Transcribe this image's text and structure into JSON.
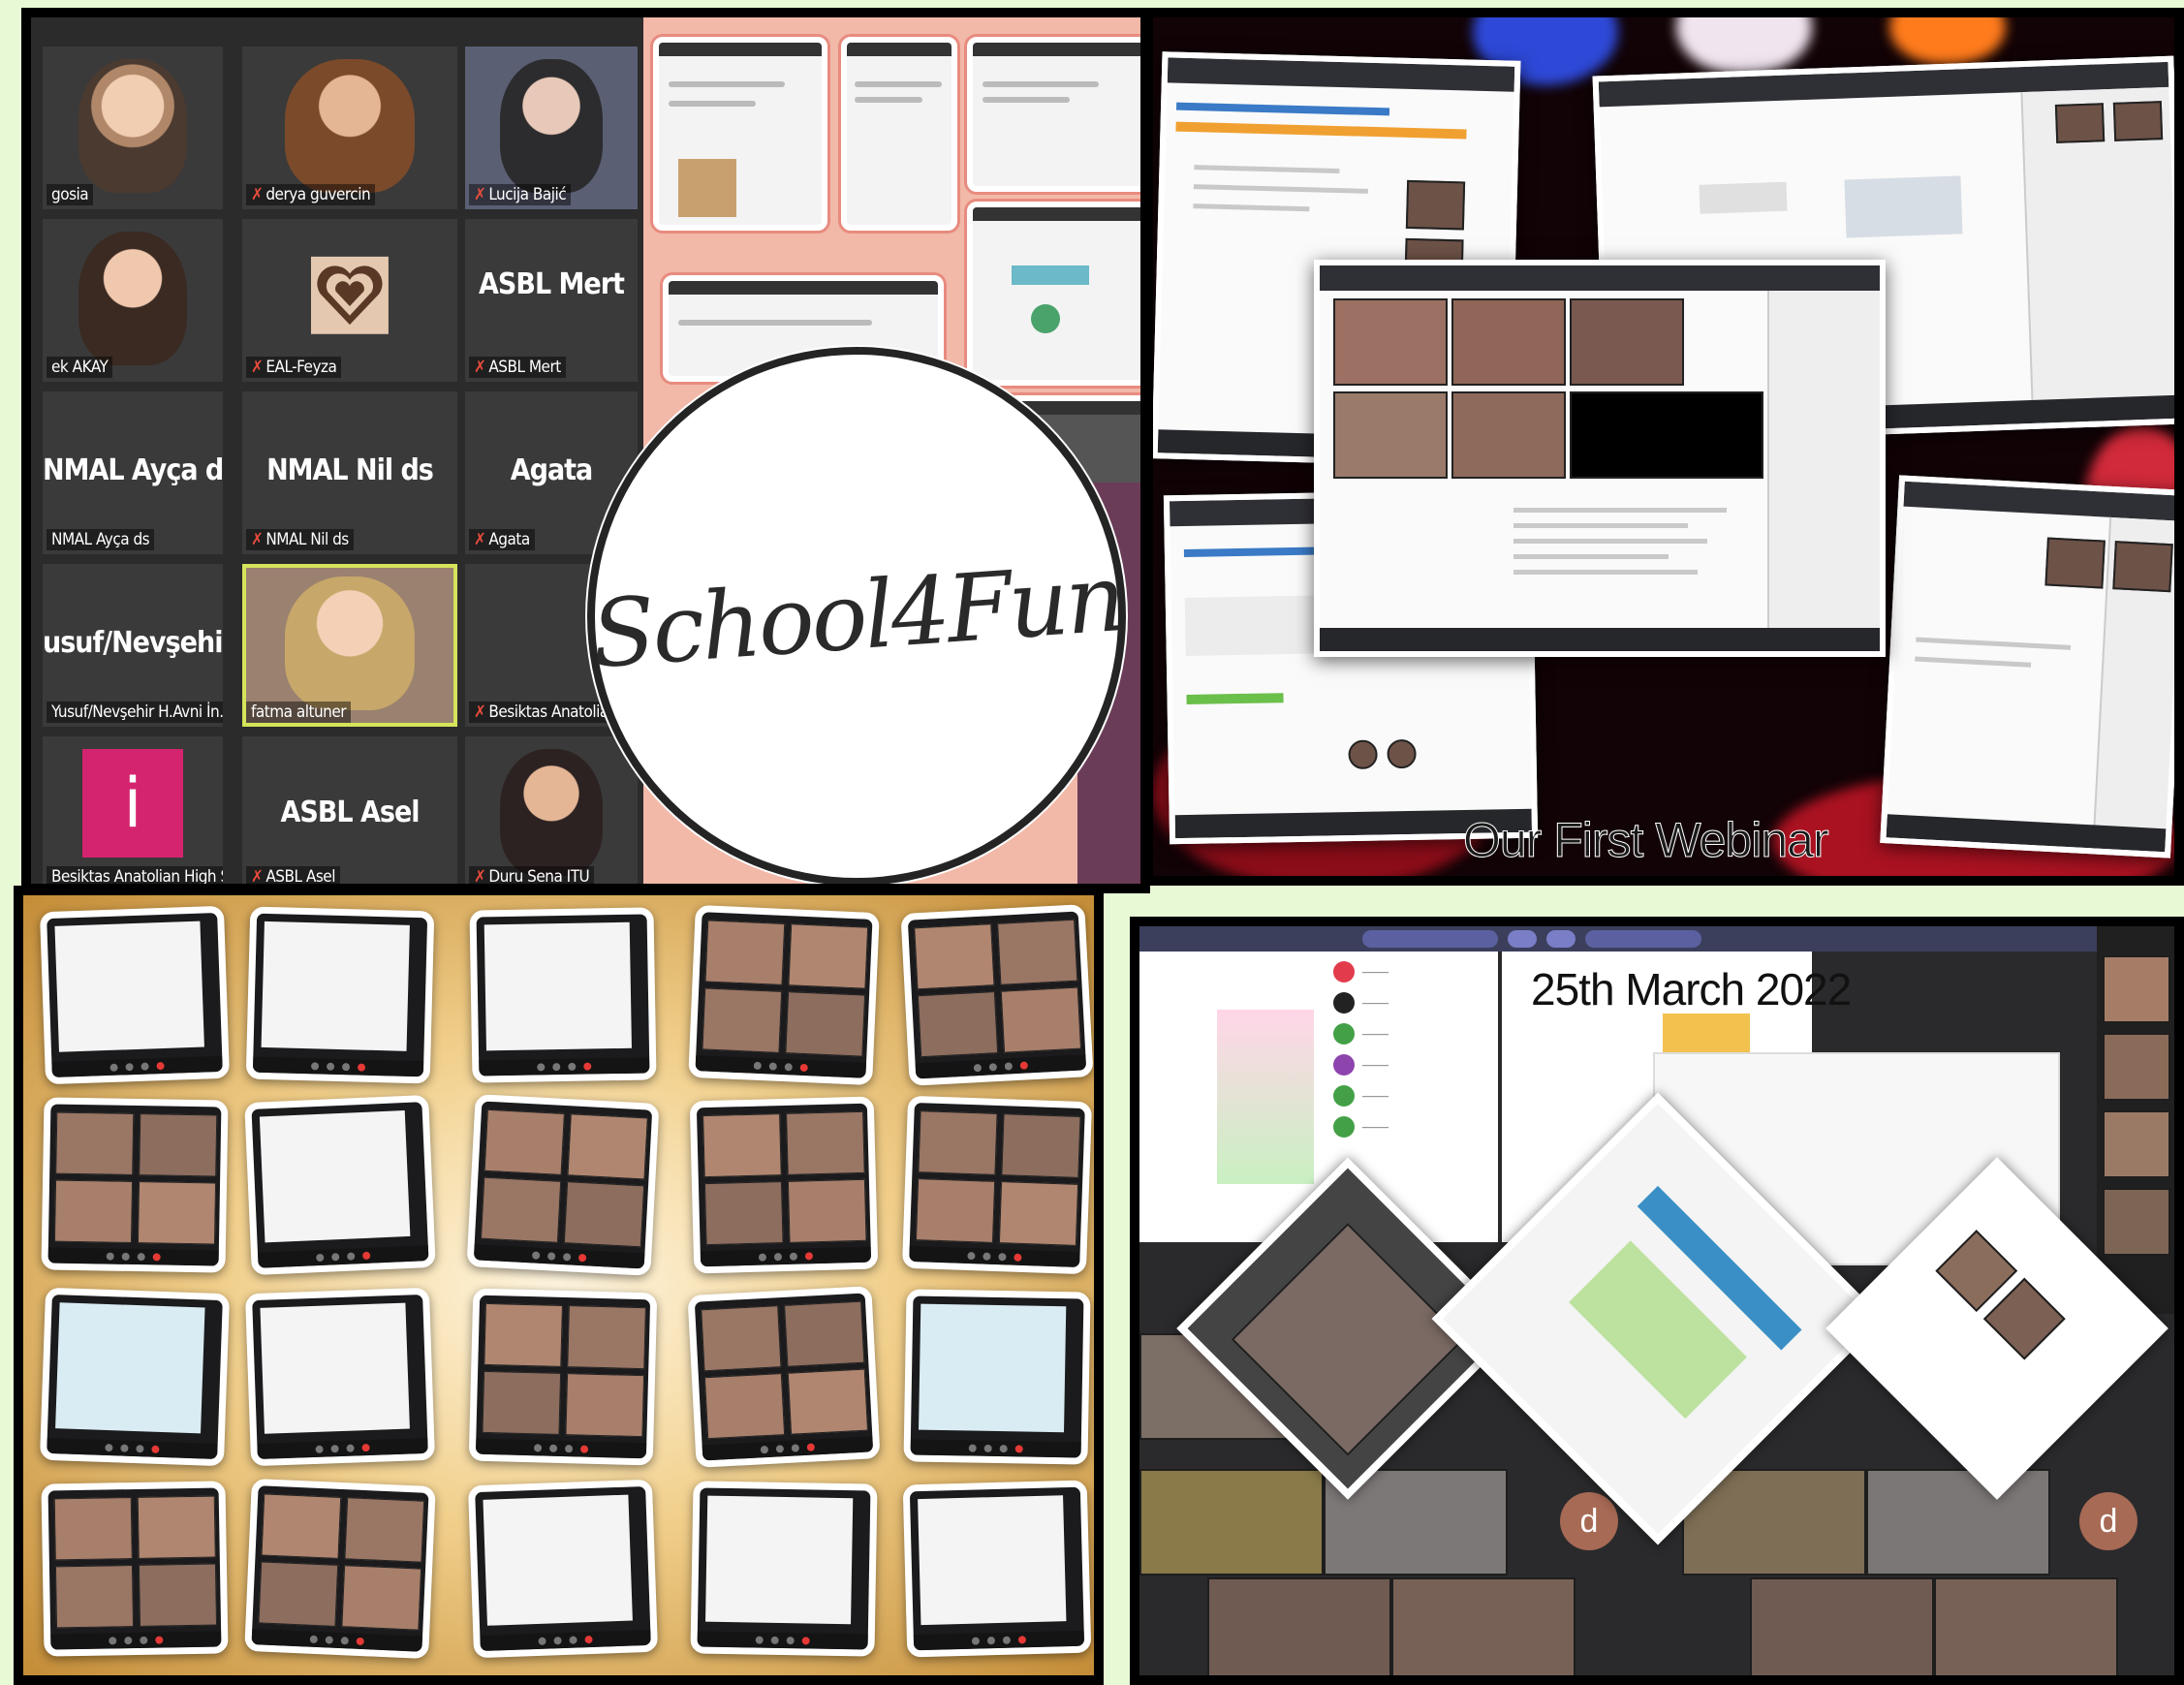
{
  "zoom_gallery": {
    "participants": [
      {
        "name": "gosia",
        "big": ""
      },
      {
        "name": "derya guvercin",
        "big": ""
      },
      {
        "name": "Lucija Bajić",
        "big": ""
      },
      {
        "name": "ek AKAY",
        "big": ""
      },
      {
        "name": "EAL-Feyza",
        "big": ""
      },
      {
        "name": "ASBL Mert",
        "big": "ASBL Mert"
      },
      {
        "name": "NMAL Ayça ds",
        "big": "NMAL Ayça ds"
      },
      {
        "name": "NMAL Nil ds",
        "big": "NMAL Nil ds"
      },
      {
        "name": "Agata",
        "big": "Agata"
      },
      {
        "name": "Yusuf/Nevşehir H.Avni İn...",
        "big": "usuf/Nevşehir..."
      },
      {
        "name": "fatma altuner",
        "big": ""
      },
      {
        "name": "Besiktas Anatolia",
        "big": ""
      },
      {
        "name": "Besiktas Anatolian High S...",
        "big": ""
      },
      {
        "name": "ASBL Asel",
        "big": "ASBL Asel"
      },
      {
        "name": "Duru Sena ITU",
        "big": ""
      }
    ],
    "pink_tile_letter": "i",
    "logo": "School4Fun"
  },
  "webinar": {
    "title": "Our First Webinar"
  },
  "meeting": {
    "date": "25th March 2022",
    "avatar_letter": "d",
    "colors": {
      "accent": "#3b3f5c",
      "avatar": "#a66a55"
    }
  },
  "colors": {
    "background": "#e8f9d6",
    "active_speaker": "#d5e45a",
    "scrapbook": "#c99a46"
  }
}
